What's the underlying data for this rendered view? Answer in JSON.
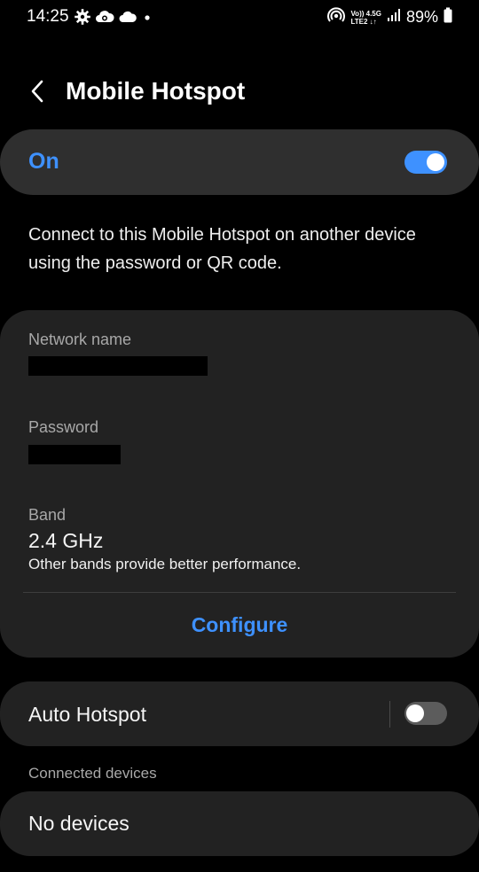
{
  "status_bar": {
    "time": "14:25",
    "network_top": "Vo)) 4.5G",
    "network_bottom": "LTE2 ↓↑",
    "battery": "89%",
    "left_icons": [
      "gear-icon",
      "cloud-sync-icon",
      "cloud-icon",
      "dot-icon"
    ],
    "right_icons": [
      "hotspot-icon",
      "signal-icon",
      "battery-icon"
    ]
  },
  "header": {
    "title": "Mobile Hotspot",
    "back_icon": "chevron-left-icon"
  },
  "master_switch": {
    "label": "On",
    "state": "on",
    "accent_color": "#3e91ff"
  },
  "description": "Connect to this Mobile Hotspot on another device using the password or QR code.",
  "info": {
    "network_name_label": "Network name",
    "password_label": "Password",
    "band_label": "Band",
    "band_value": "2.4 GHz",
    "band_note": "Other bands provide better performance.",
    "configure_label": "Configure"
  },
  "auto_hotspot": {
    "label": "Auto Hotspot",
    "state": "off"
  },
  "connected_devices": {
    "section_label": "Connected devices",
    "empty_label": "No devices"
  }
}
